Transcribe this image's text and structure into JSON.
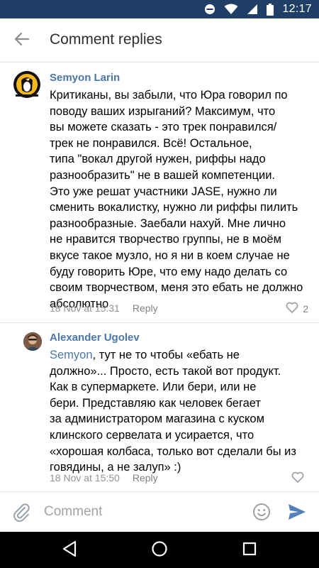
{
  "status_bar": {
    "time": "12:17",
    "icons": [
      "dnd-icon",
      "wifi-icon",
      "signal-icon",
      "battery-icon"
    ]
  },
  "header": {
    "title": "Comment replies",
    "back_icon": "arrow-left-icon"
  },
  "comments": [
    {
      "author": "Semyon Larin",
      "avatar": "penguins-logo-avatar",
      "text_lines": [
        "Критиканы, вы забыли, что Юра говорил по",
        "поводу ваших изрыганий? Максимум, что",
        "вы можете сказать - это трек понравился/",
        "трек не понравился. Всё! Остальное,",
        "типа \"вокал другой нужен, риффы надо",
        "разнообразить\" не в вашей компетенции.",
        "Это уже решат участники JASE, нужно ли",
        "сменить вокалистку, нужно ли риффы пилить",
        "разнообразные. Заебали нахуй. Мне лично",
        "не нравится творчество группы, не в моём",
        "вкусе такое музло, но я ни в коем случае не",
        "буду говорить Юре, что ему надо делать со",
        "своим творчеством, меня это ебать не должно",
        "абсолютно"
      ],
      "date": "18 Nov at 15:31",
      "reply_label": "Reply",
      "likes": "2",
      "liked": false
    },
    {
      "author": "Alexander Ugolev",
      "avatar": "user-photo-avatar",
      "mention": "Semyon",
      "first_line_rest": ", тут не то чтобы «ебать не",
      "text_lines": [
        "должно»... Просто, есть такой вот продукт.",
        "Как в супермаркете. Или бери, или не",
        "бери. Представляю как человек бегает",
        "за администратором магазина с куском",
        "клинского сервелата и усирается, что",
        "«хорошая колбаса, только вот сделали бы из",
        "говядины, а не залуп» :)"
      ],
      "date": "18 Nov at 15:50",
      "reply_label": "Reply",
      "likes": "",
      "liked": false
    }
  ],
  "composer": {
    "placeholder": "Comment",
    "value": "",
    "icons": [
      "paperclip-icon",
      "emoji-icon",
      "send-icon"
    ]
  },
  "nav_bar": {
    "icons": [
      "nav-back-icon",
      "nav-home-icon",
      "nav-recents-icon"
    ]
  },
  "colors": {
    "status_bar": "#1f3f66",
    "link_blue": "#4a76a8",
    "send_blue": "#5181b8",
    "meta_gray": "#939393"
  }
}
